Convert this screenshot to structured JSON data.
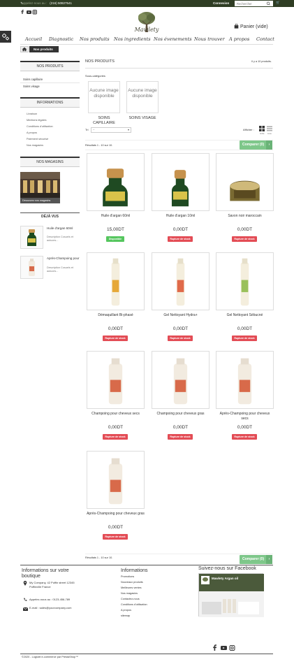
{
  "topbar": {
    "phone_label": "Appelez-nous au :",
    "phone_number": "(216) 50827541",
    "login": "Connexion",
    "search_placeholder": "Rechercher"
  },
  "header": {
    "logo_text": "Mawlety",
    "cart": "Panier (vide)"
  },
  "nav": [
    "Accueil",
    "Diagnostic",
    "Nos produits",
    "Nos ingredients",
    "Nos évenements",
    "Nous trouver",
    "A propos",
    "Contact"
  ],
  "breadcrumb": {
    "current": "Nos produits"
  },
  "sidebar": {
    "products_title": "NOS PRODUITS",
    "products": [
      "Soins capillaire",
      "Soins visage"
    ],
    "info_title": "INFORMATIONS",
    "info": [
      "Livraison",
      "Mentions légales",
      "Conditions d'utilisation",
      "A propos",
      "Paiement sécurisé",
      "Nos magasins"
    ],
    "stores_title": "NOS MAGASINS",
    "stores_button": "Découvrez nos magasins",
    "seen_title": "DÉJÀ VUS",
    "seen": [
      {
        "name": "Huile d'argan 60ml",
        "desc": "Description Cosuels et autuces..."
      },
      {
        "name": "Après-Champoing pour",
        "desc": "Description Cosuels et autuces..."
      }
    ]
  },
  "main": {
    "title": "NOS PRODUITS",
    "count": "Il y a 10 produits.",
    "subcat_label": "Sous-catégories",
    "no_image": "Aucune image disponible",
    "subcats": [
      "SOINS CAPILLAIRE",
      "SOINS VISAGE"
    ],
    "sort_label": "Tri",
    "sort_value": "--",
    "view_label": "Afficher :",
    "view_grid": "Grille",
    "view_list": "Liste",
    "results": "Résultats 1 - 10 sur 10.",
    "compare": "Comparer (0)",
    "out_of_stock": "Rupture de stock",
    "in_stock": "Disponible",
    "products": [
      {
        "name": "Huile d'argan 60ml",
        "price": "15,00DT",
        "status": "in"
      },
      {
        "name": "Huile d'argan 10ml",
        "price": "0,00DT",
        "status": "out"
      },
      {
        "name": "Savon noir maroccain",
        "price": "0,00DT",
        "status": "out"
      },
      {
        "name": "Démaquillant Bi-phasé",
        "price": "0,00DT",
        "status": "out"
      },
      {
        "name": "Gel Nettoyant Hydra+",
        "price": "0,00DT",
        "status": "out"
      },
      {
        "name": "Gel Nettoyant Sébucné",
        "price": "0,00DT",
        "status": "out"
      },
      {
        "name": "Champoing pour cheveux secs",
        "price": "0,00DT",
        "status": "out"
      },
      {
        "name": "Champoing pour cheveux gras",
        "price": "0,00DT",
        "status": "out"
      },
      {
        "name": "Après-Champoing pour cheveux secs",
        "price": "0,00DT",
        "status": "out"
      },
      {
        "name": "Après-Champoing pour cheveux gras",
        "price": "0,00DT",
        "status": "out"
      }
    ]
  },
  "footer": {
    "store_title": "Informations sur votre boutique",
    "address": "My Company, 42 Puffin street 12345 Puffinville France",
    "phone": "Appelez-nous au : 0123-456-789",
    "email": "E-mail : sales@yourcompany.com",
    "info_title": "Informations",
    "links": [
      "Promotions",
      "Nouveaux produits",
      "Meilleures ventes",
      "Nos magasins",
      "Contactez-nous",
      "Conditions d'utilisation",
      "A propos",
      "sitemap"
    ],
    "fb_title": "Suivez-nous sur Facebook",
    "fb_page": "Mawlety Argan oil",
    "copyright": "©2020 - Logiciel e-commerce par PrestaShop™"
  },
  "colors": {
    "topbar": "#2f3d24",
    "compare": "#7ec78a",
    "out": "#e34c55",
    "in": "#55c65e"
  }
}
